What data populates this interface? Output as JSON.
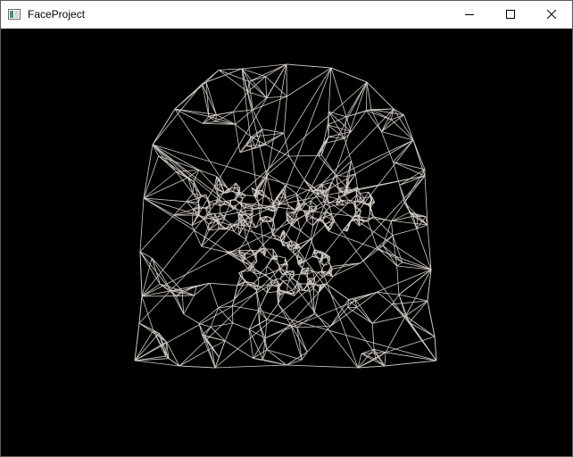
{
  "window": {
    "title": "FaceProject",
    "controls": {
      "minimize_icon": "minimize-icon",
      "maximize_icon": "maximize-icon",
      "close_icon": "close-icon"
    }
  },
  "viewport": {
    "background": "#000000",
    "mesh_color": "#d2cdc6",
    "content": "wireframe-face-mesh"
  }
}
